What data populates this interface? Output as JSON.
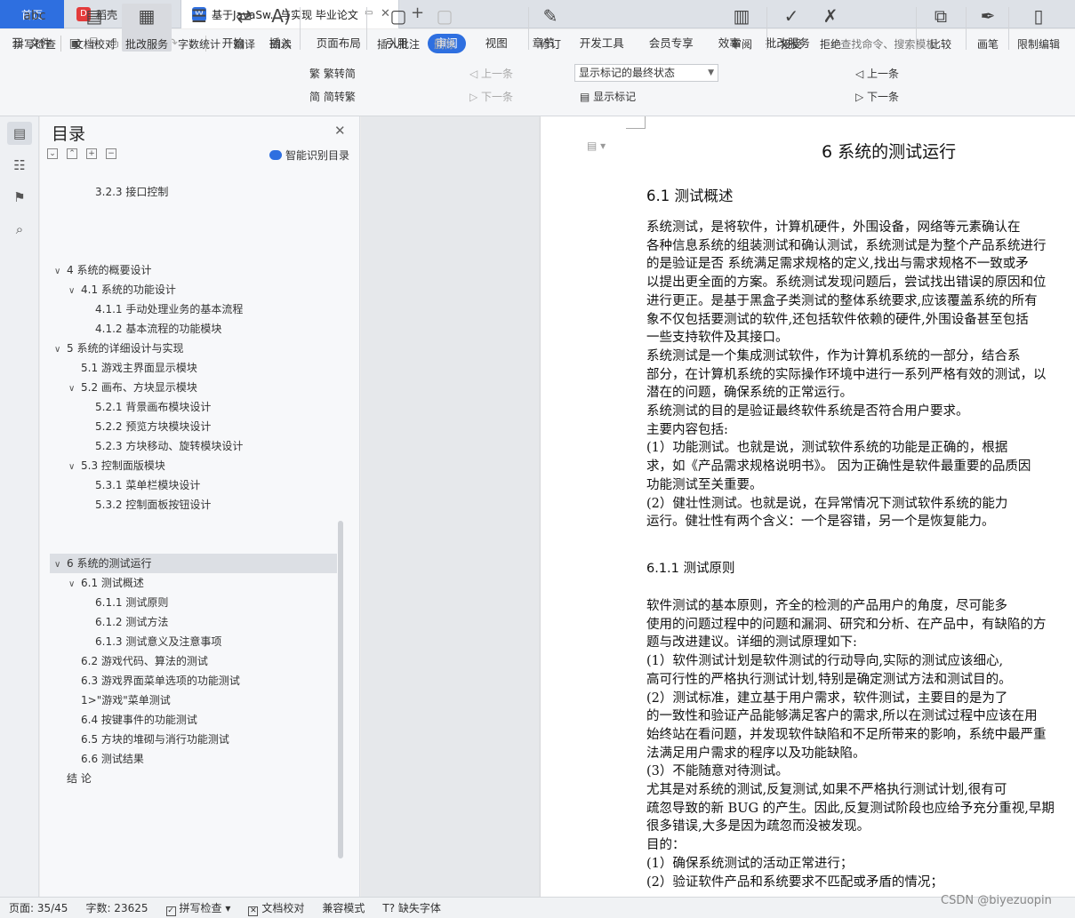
{
  "tabs": {
    "home": "首页",
    "daoke": "稻壳",
    "doc": "基于JavaSw...与实现 毕业论文",
    "daoke_icon": "daoke-logo-icon",
    "doc_icon": "w-doc-icon"
  },
  "menu": {
    "file": "文件",
    "items": [
      "开始",
      "插入",
      "页面布局",
      "引用",
      "审阅",
      "视图",
      "章节",
      "开发工具",
      "会员专享",
      "效率",
      "批改服务"
    ],
    "active_index": 4,
    "search": "查找命令、搜索模板"
  },
  "ribbon": {
    "spell": "拼写检查",
    "proofread": "文档校对",
    "correction": "批改服务",
    "wordcount": "字数统计",
    "translate": "翻译",
    "read": "朗读",
    "trad": "繁转简",
    "simp": "简转繁",
    "insert_comment": "插入批注",
    "delete": "删除",
    "prev1": "上一条",
    "next1": "下一条",
    "track": "修订",
    "combo": "显示标记的最终状态",
    "show_markup": "显示标记",
    "review": "审阅",
    "accept": "接受",
    "reject": "拒绝",
    "prev2": "上一条",
    "next2": "下一条",
    "compare": "比较",
    "pen": "画笔",
    "restrict": "限制编辑"
  },
  "toc": {
    "title": "目录",
    "smart": "智能识别目录",
    "items": [
      {
        "text": "3.2.3    接口控制",
        "level": 3,
        "chev": ""
      },
      {
        "text": "4    系统的概要设计",
        "level": 1,
        "chev": "∨"
      },
      {
        "text": "4.1    系统的功能设计",
        "level": 2,
        "chev": "∨"
      },
      {
        "text": "4.1.1    手动处理业务的基本流程",
        "level": 3,
        "chev": ""
      },
      {
        "text": "4.1.2    基本流程的功能模块",
        "level": 3,
        "chev": ""
      },
      {
        "text": "5    系统的详细设计与实现",
        "level": 1,
        "chev": "∨"
      },
      {
        "text": "5.1    游戏主界面显示模块",
        "level": 2,
        "chev": ""
      },
      {
        "text": "5.2    画布、方块显示模块",
        "level": 2,
        "chev": "∨"
      },
      {
        "text": "5.2.1    背景画布模块设计",
        "level": 3,
        "chev": ""
      },
      {
        "text": "5.2.2    预览方块模块设计",
        "level": 3,
        "chev": ""
      },
      {
        "text": "5.2.3    方块移动、旋转模块设计",
        "level": 3,
        "chev": ""
      },
      {
        "text": "5.3    控制面版模块",
        "level": 2,
        "chev": "∨"
      },
      {
        "text": "5.3.1    菜单栏模块设计",
        "level": 3,
        "chev": ""
      },
      {
        "text": "5.3.2    控制面板按钮设计",
        "level": 3,
        "chev": ""
      },
      {
        "text": "6  系统的测试运行",
        "level": 1,
        "chev": "∨",
        "highlight": true
      },
      {
        "text": "6.1  测试概述",
        "level": 2,
        "chev": "∨"
      },
      {
        "text": "6.1.1    测试原则",
        "level": 3,
        "chev": ""
      },
      {
        "text": "6.1.2    测试方法",
        "level": 3,
        "chev": ""
      },
      {
        "text": "6.1.3    测试意义及注意事项",
        "level": 3,
        "chev": ""
      },
      {
        "text": "6.2 游戏代码、算法的测试",
        "level": 2,
        "chev": ""
      },
      {
        "text": "6.3 游戏界面菜单选项的功能测试",
        "level": 2,
        "chev": ""
      },
      {
        "text": "1>\"游戏\"菜单测试",
        "level": 2,
        "chev": ""
      },
      {
        "text": "6.4 按键事件的功能测试",
        "level": 2,
        "chev": ""
      },
      {
        "text": "6.5 方块的堆砌与消行功能测试",
        "level": 2,
        "chev": ""
      },
      {
        "text": "6.6    测试结果",
        "level": 2,
        "chev": ""
      },
      {
        "text": "结    论",
        "level": 1,
        "chev": ""
      }
    ]
  },
  "doc": {
    "h1": "6  系统的测试运行",
    "h2": "6.1  测试概述",
    "h3": "6.1.1    测试原则",
    "p1": [
      "    系统测试，是将软件，计算机硬件，外围设备，网络等元素确认在",
      "各种信息系统的组装测试和确认测试，系统测试是为整个产品系统进行",
      "的是验证是否  系统满足需求规格的定义,找出与需求规格不一致或矛",
      "以提出更全面的方案。系统测试发现问题后，尝试找出错误的原因和位",
      "进行更正。是基于黑盒子类测试的整体系统要求,应该覆盖系统的所有",
      "象不仅包括要测试的软件,还包括软件依赖的硬件,外围设备甚至包括",
      "一些支持软件及其接口。",
      "    系统测试是一个集成测试软件，作为计算机系统的一部分，结合系",
      "部分，在计算机系统的实际操作环境中进行一系列严格有效的测试，以",
      "潜在的问题，确保系统的正常运行。",
      "    系统测试的目的是验证最终软件系统是否符合用户要求。",
      "    主要内容包括:",
      "    (1）功能测试。也就是说，测试软件系统的功能是正确的，根据",
      "求，如《产品需求规格说明书》。  因为正确性是软件最重要的品质因",
      "功能测试至关重要。",
      "    (2）健壮性测试。也就是说，在异常情况下测试软件系统的能力",
      "运行。健壮性有两个含义：一个是容错，另一个是恢复能力。"
    ],
    "p2": [
      "     软件测试的基本原则，齐全的检测的产品用户的角度，尽可能多",
      "使用的问题过程中的问题和漏洞、研究和分析、在产品中，有缺陷的方",
      "题与改进建议。详细的测试原理如下:",
      "     (1）软件测试计划是软件测试的行动导向,实际的测试应该细心,",
      "高可行性的严格执行测试计划,特别是确定测试方法和测试目的。",
      "     (2）测试标准，建立基于用户需求，软件测试，主要目的是为了",
      "的一致性和验证产品能够满足客户的需求,所以在测试过程中应该在用",
      "始终站在看问题，并发现软件缺陷和不足所带来的影响，系统中最严重",
      "法满足用户需求的程序以及功能缺陷。",
      "     (3）不能随意对待测试。",
      "    尤其是对系统的测试,反复测试,如果不严格执行测试计划,很有可",
      "疏忽导致的新 BUG 的产生。因此,反复测试阶段也应给予充分重视,早期",
      "很多错误,大多是因为疏忽而没被发现。",
      "     目的：",
      "     (1）确保系统测试的活动正常进行；",
      "     (2）验证软件产品和系统要求不匹配或矛盾的情况；"
    ]
  },
  "status": {
    "page": "页面: 35/45",
    "words": "字数: 23625",
    "spell": "拼写检查",
    "proof": "文档校对",
    "compat": "兼容模式",
    "missing_font": "缺失字体"
  },
  "watermark": "CSDN @biyezuopin",
  "colors": {
    "accent": "#2e6fe0",
    "daoke": "#e33b3b"
  }
}
